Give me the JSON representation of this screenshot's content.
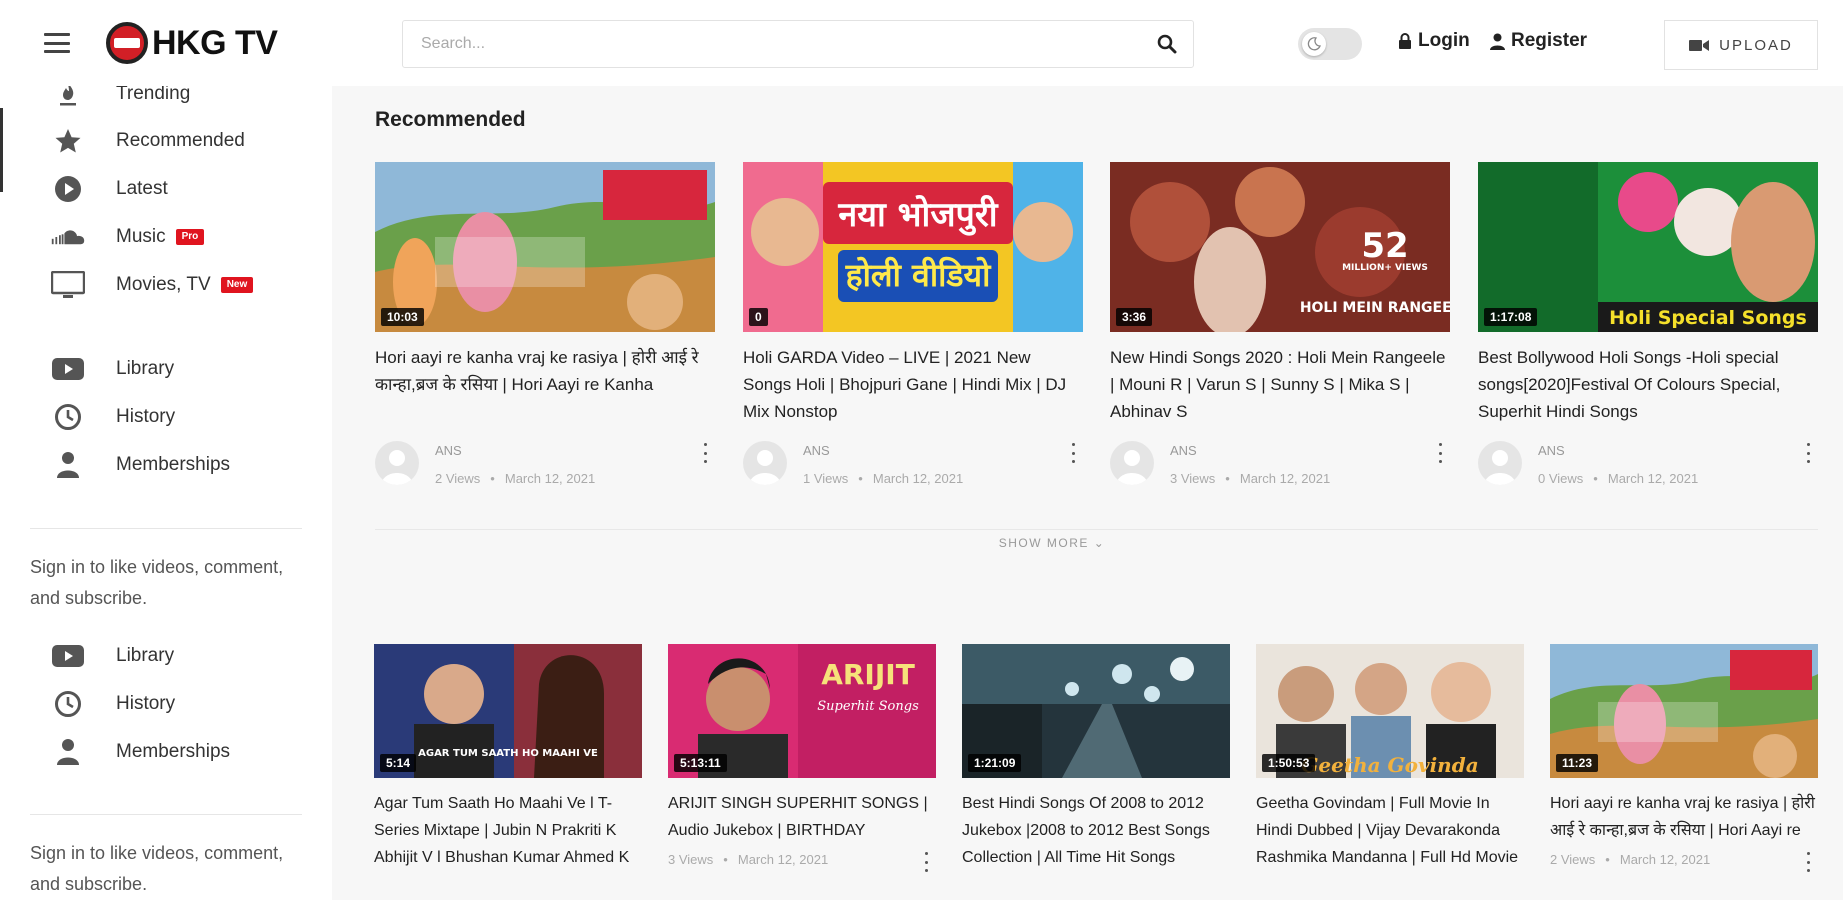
{
  "header": {
    "logo_text": "HKG TV",
    "search_placeholder": "Search...",
    "login_label": "Login",
    "register_label": "Register",
    "upload_label": "UPLOAD"
  },
  "sidebar": {
    "items": [
      {
        "label": "Trending",
        "icon": "fire-icon"
      },
      {
        "label": "Recommended",
        "icon": "star-icon"
      },
      {
        "label": "Latest",
        "icon": "play-circle-icon"
      },
      {
        "label": "Music",
        "icon": "soundcloud-icon",
        "badge": "Pro"
      },
      {
        "label": "Movies, TV",
        "icon": "tv-icon",
        "badge": "New"
      }
    ],
    "library_items": [
      {
        "label": "Library",
        "icon": "youtube-icon"
      },
      {
        "label": "History",
        "icon": "history-icon"
      },
      {
        "label": "Memberships",
        "icon": "user-icon"
      }
    ],
    "note": "Sign in to like videos, comment, and subscribe.",
    "library_items_2": [
      {
        "label": "Library",
        "icon": "youtube-icon"
      },
      {
        "label": "History",
        "icon": "history-icon"
      },
      {
        "label": "Memberships",
        "icon": "user-icon"
      }
    ],
    "note_2": "Sign in to like videos, comment, and subscribe."
  },
  "main": {
    "section_title": "Recommended",
    "show_more": "SHOW MORE",
    "recommended": [
      {
        "title": "Hori aayi re kanha vraj ke rasiya | होरी आई रे कान्हा,ब्रज के रसिया | Hori Aayi re Kanha",
        "duration": "10:03",
        "channel": "ANS",
        "views": "2 Views",
        "date": "March 12, 2021"
      },
      {
        "title": "Holi GARDA Video – LIVE | 2021 New Songs Holi | Bhojpuri Gane | Hindi Mix | DJ Mix Nonstop",
        "duration": "0",
        "channel": "ANS",
        "views": "1 Views",
        "date": "March 12, 2021"
      },
      {
        "title": "New Hindi Songs 2020 : Holi Mein Rangeele | Mouni R | Varun S | Sunny S | Mika S | Abhinav S",
        "duration": "3:36",
        "channel": "ANS",
        "views": "3 Views",
        "date": "March 12, 2021"
      },
      {
        "title": "Best Bollywood Holi Songs -Holi special songs[2020]Festival Of Colours Special, Superhit Hindi Songs",
        "duration": "1:17:08",
        "channel": "ANS",
        "views": "0 Views",
        "date": "March 12, 2021"
      }
    ],
    "row2": [
      {
        "title": "Agar Tum Saath Ho Maahi Ve l T-Series Mixtape | Jubin N Prakriti K Abhijit V l Bhushan Kumar Ahmed K",
        "duration": "5:14"
      },
      {
        "title": "ARIJIT SINGH SUPERHIT SONGS | Audio Jukebox | BIRTHDAY SPECIAL | T-Series",
        "duration": "5:13:11",
        "views": "3 Views",
        "date": "March 12, 2021"
      },
      {
        "title": "Best Hindi Songs Of 2008 to 2012 Jukebox |2008 to 2012 Best Songs Collection | All Time Hit Songs",
        "duration": "1:21:09"
      },
      {
        "title": "Geetha Govindam | Full Movie In Hindi Dubbed | Vijay Devarakonda Rashmika Mandanna | Full Hd Movie",
        "duration": "1:50:53"
      },
      {
        "title": "Hori aayi re kanha vraj ke rasiya | होरी आई रे कान्हा,ब्रज के रसिया | Hori Aayi re Kanha",
        "duration": "11:23",
        "views": "2 Views",
        "date": "March 12, 2021"
      }
    ],
    "thumb_texts": {
      "t2_line1": "नया भोजपुरी",
      "t2_line2": "होली वीडियो",
      "t3_big": "52",
      "t3_small": "MILLION+ VIEWS",
      "t3_caption": "HOLI MEIN RANGEELE",
      "t4_caption": "Holi Special Songs",
      "r2_1_caption": "AGAR TUM SAATH HO MAAHI VE",
      "r2_2_caption": "ARIJIT",
      "r2_2_sub": "Superhit Songs",
      "r2_4_caption": "Geetha Govinda"
    }
  },
  "colors": {
    "accent_red": "#e0141f",
    "main_bg": "#f7f7f7"
  }
}
